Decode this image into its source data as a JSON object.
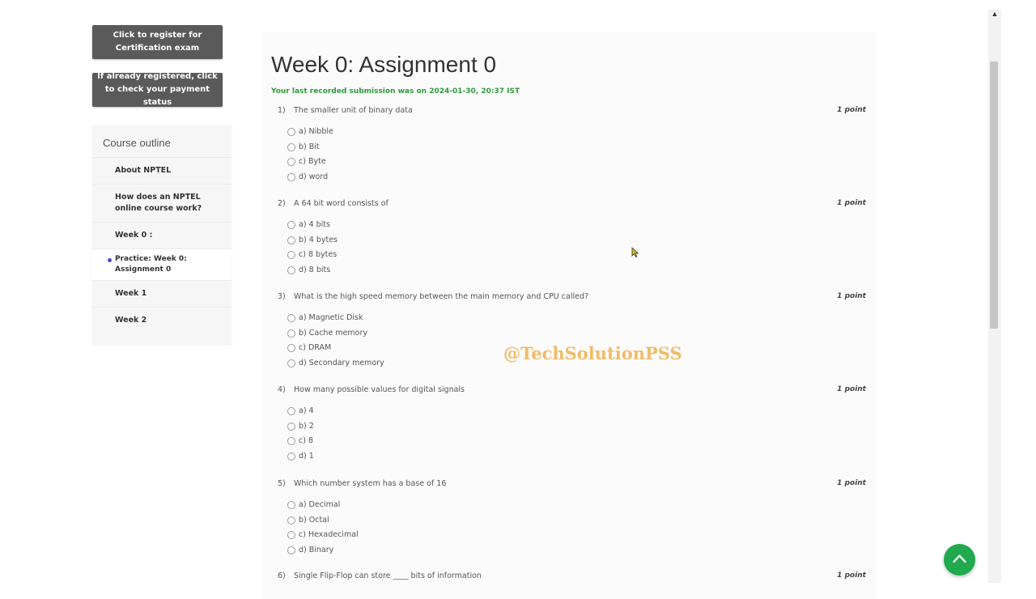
{
  "left": {
    "register_button": "Click to register for Certification exam",
    "payment_button": "If already registered, click to check your payment status",
    "outline_title": "Course outline",
    "outline_items": [
      {
        "label": "About NPTEL"
      },
      {
        "label": "How does an NPTEL online course work?"
      },
      {
        "label": "Week 0 :"
      },
      {
        "label": "Practice: Week 0: Assignment 0",
        "active": true
      },
      {
        "label": "Week 1"
      },
      {
        "label": "Week 2"
      }
    ]
  },
  "main": {
    "title": "Week 0: Assignment 0",
    "submission": "Your last recorded submission was on 2024-01-30, 20:37 IST",
    "questions": [
      {
        "num": "1)",
        "text": "The smaller unit of binary data",
        "points": "1 point",
        "options": [
          "a) Nibble",
          "b) Bit",
          "c) Byte",
          "d) word"
        ]
      },
      {
        "num": "2)",
        "text": "A 64 bit word consists of",
        "points": "1 point",
        "options": [
          "a) 4 bits",
          "b) 4 bytes",
          "c) 8 bytes",
          "d) 8 bits"
        ]
      },
      {
        "num": "3)",
        "text": "What is the high speed memory between the main memory and CPU called?",
        "points": "1 point",
        "options": [
          "a) Magnetic Disk",
          "b) Cache memory",
          "c) DRAM",
          "d) Secondary memory"
        ]
      },
      {
        "num": "4)",
        "text": "How many possible values for digital signals",
        "points": "1 point",
        "options": [
          "a) 4",
          "b) 2",
          "c) 8",
          "d) 1"
        ]
      },
      {
        "num": "5)",
        "text": "Which number system has a base of 16",
        "points": "1 point",
        "options": [
          "a) Decimal",
          "b) Octal",
          "c) Hexadecimal",
          "d) Binary"
        ]
      },
      {
        "num": "6)",
        "text": "Single Flip-Flop can store ____ bits of information",
        "points": "1 point",
        "options": []
      }
    ]
  },
  "watermark": "@TechSolutionPSS",
  "icons": {
    "scroll_up": "caret-up-icon",
    "back_to_top": "chevron-up-icon",
    "cursor": "mouse-pointer-icon"
  },
  "colors": {
    "submission": "#2e9b3a",
    "back_to_top": "#20a94f",
    "watermark": "#f0b65a"
  }
}
